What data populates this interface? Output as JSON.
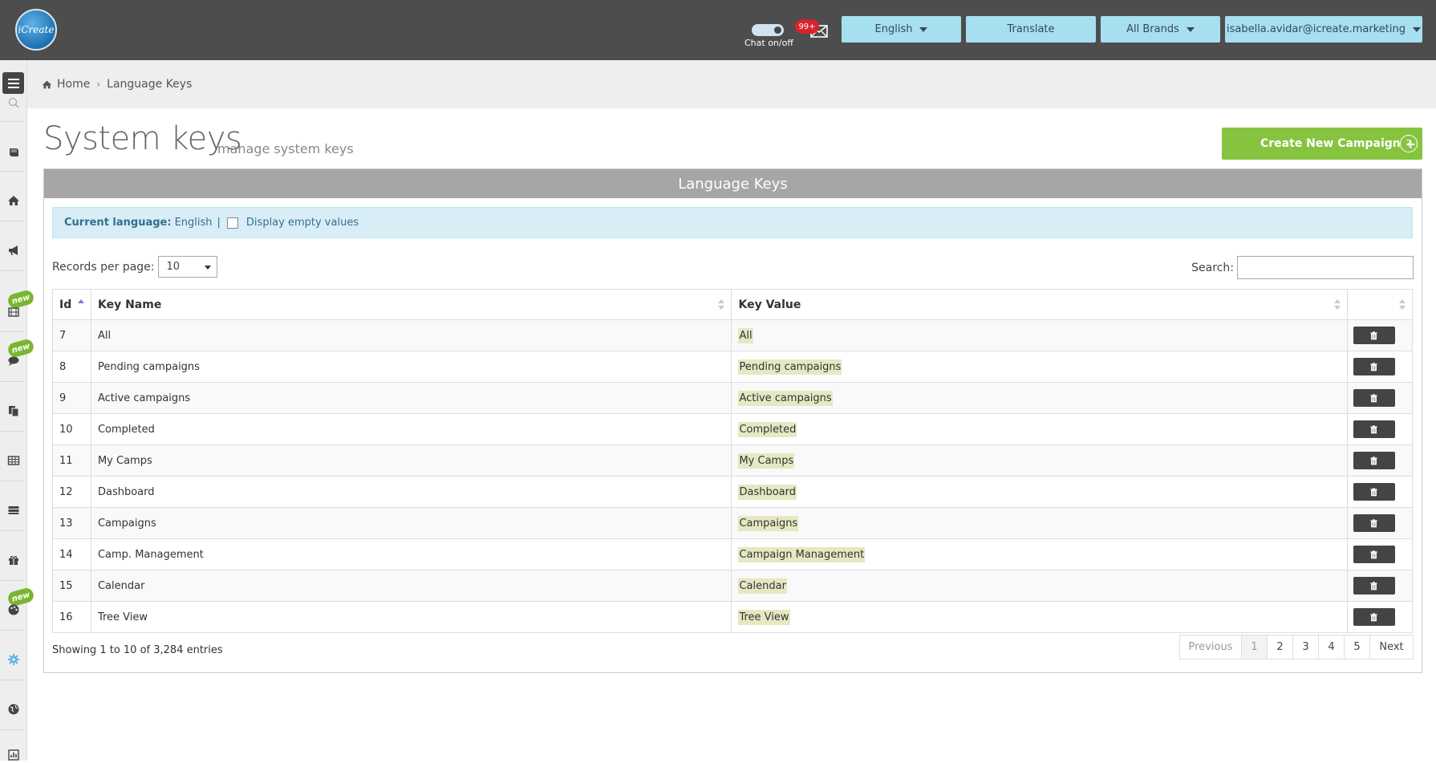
{
  "header": {
    "logo_text": "iCreate",
    "chat_label": "Chat on/off",
    "mail_badge": "99+",
    "language_button": "English",
    "translate_button": "Translate",
    "brands_button": "All Brands",
    "user_button": "isabella.avidar@icreate.marketing"
  },
  "sidebar": {
    "new_badge": "new"
  },
  "breadcrumb": {
    "home": "Home",
    "current": "Language Keys"
  },
  "page": {
    "title": "System keys",
    "subtitle": "manage system keys",
    "create_button": "Create New Campaign",
    "help": "?"
  },
  "panel": {
    "title": "Language Keys",
    "current_language_label": "Current language:",
    "current_language_value": "English",
    "separator": "|",
    "display_empty_label": "Display empty values",
    "records_per_page_label": "Records per page:",
    "records_per_page_value": "10",
    "search_label": "Search:",
    "search_value": ""
  },
  "table": {
    "columns": [
      "Id",
      "Key Name",
      "Key Value"
    ],
    "rows": [
      {
        "id": "7",
        "name": "All",
        "value": "All"
      },
      {
        "id": "8",
        "name": "Pending campaigns",
        "value": "Pending campaigns"
      },
      {
        "id": "9",
        "name": "Active campaigns",
        "value": "Active campaigns"
      },
      {
        "id": "10",
        "name": "Completed",
        "value": "Completed"
      },
      {
        "id": "11",
        "name": "My Camps",
        "value": "My Camps"
      },
      {
        "id": "12",
        "name": "Dashboard",
        "value": "Dashboard"
      },
      {
        "id": "13",
        "name": "Campaigns",
        "value": "Campaigns"
      },
      {
        "id": "14",
        "name": "Camp. Management",
        "value": "Campaign Management"
      },
      {
        "id": "15",
        "name": "Calendar",
        "value": "Calendar"
      },
      {
        "id": "16",
        "name": "Tree View",
        "value": "Tree View"
      }
    ]
  },
  "footer": {
    "showing": "Showing 1 to 10 of 3,284 entries",
    "pager": {
      "previous": "Previous",
      "pages": [
        "1",
        "2",
        "3",
        "4",
        "5"
      ],
      "next": "Next"
    }
  },
  "colors": {
    "header_bg": "#4d4d4d",
    "header_button": "#a5dff0",
    "create_button": "#86c440",
    "panel_head": "#a6a6a6",
    "info_bar": "#d9edf7",
    "value_highlight": "#e5e8c2"
  }
}
